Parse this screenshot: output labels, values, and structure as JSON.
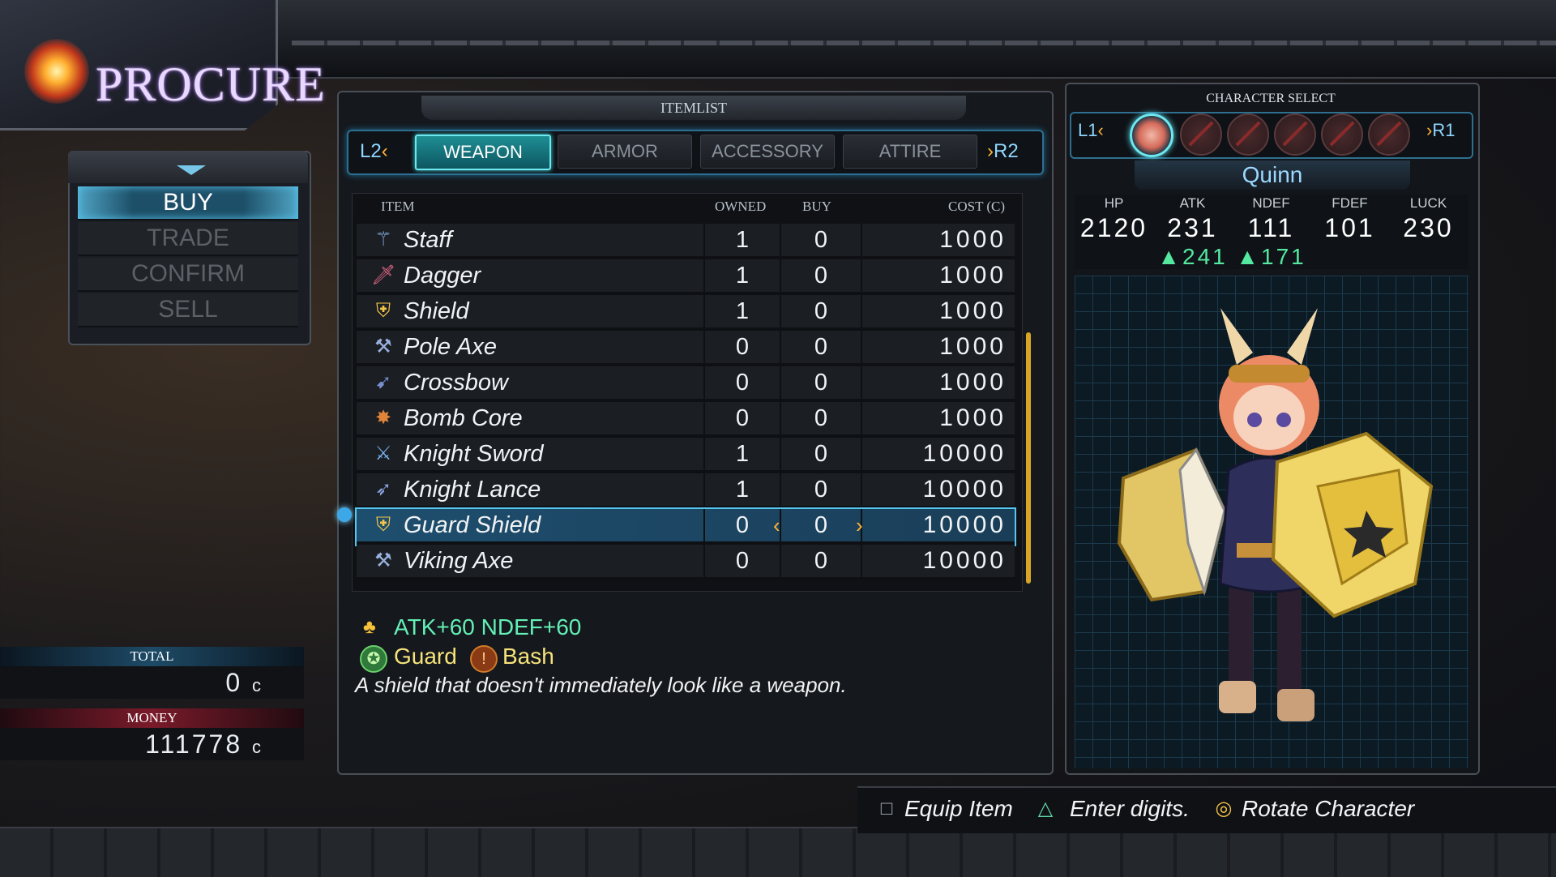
{
  "screen": {
    "title": "PROCURE"
  },
  "menu": {
    "items": [
      "BUY",
      "TRADE",
      "CONFIRM",
      "SELL"
    ],
    "active": "BUY"
  },
  "totals": {
    "total_label": "TOTAL",
    "total_value": "0",
    "money_label": "MONEY",
    "money_value": "111778",
    "currency": "c"
  },
  "itemlist": {
    "header": "ITEMLIST",
    "tab_left": "L2",
    "tab_right": "R2",
    "tabs": [
      "WEAPON",
      "ARMOR",
      "ACCESSORY",
      "ATTIRE"
    ],
    "active_tab": "WEAPON",
    "columns": {
      "item": "ITEM",
      "owned": "OWNED",
      "buy": "BUY",
      "cost": "COST (C)"
    },
    "rows": [
      {
        "name": "Staff",
        "owned": "1",
        "buy": "0",
        "cost": "1000",
        "icon": "staff-icon"
      },
      {
        "name": "Dagger",
        "owned": "1",
        "buy": "0",
        "cost": "1000",
        "icon": "dagger-icon"
      },
      {
        "name": "Shield",
        "owned": "1",
        "buy": "0",
        "cost": "1000",
        "icon": "shield-icon"
      },
      {
        "name": "Pole Axe",
        "owned": "0",
        "buy": "0",
        "cost": "1000",
        "icon": "axe-icon"
      },
      {
        "name": "Crossbow",
        "owned": "0",
        "buy": "0",
        "cost": "1000",
        "icon": "crossbow-icon"
      },
      {
        "name": "Bomb Core",
        "owned": "0",
        "buy": "0",
        "cost": "1000",
        "icon": "bomb-icon"
      },
      {
        "name": "Knight Sword",
        "owned": "1",
        "buy": "0",
        "cost": "10000",
        "icon": "sword-icon"
      },
      {
        "name": "Knight Lance",
        "owned": "1",
        "buy": "0",
        "cost": "10000",
        "icon": "lance-icon"
      },
      {
        "name": "Guard Shield",
        "owned": "0",
        "buy": "0",
        "cost": "10000",
        "icon": "shield-icon",
        "selected": true
      },
      {
        "name": "Viking Axe",
        "owned": "0",
        "buy": "0",
        "cost": "10000",
        "icon": "axe-icon"
      }
    ]
  },
  "description": {
    "stats": "ATK+60 NDEF+60",
    "skill1": "Guard",
    "skill2": "Bash",
    "text": "A shield that doesn't immediately look like a weapon."
  },
  "character": {
    "select_label": "CHARACTER SELECT",
    "left": "L1",
    "right": "R1",
    "name": "Quinn",
    "stats": [
      {
        "label": "HP",
        "value": "2120",
        "up": ""
      },
      {
        "label": "ATK",
        "value": "231",
        "up": "▲241"
      },
      {
        "label": "NDEF",
        "value": "111",
        "up": "▲171"
      },
      {
        "label": "FDEF",
        "value": "101",
        "up": ""
      },
      {
        "label": "LUCK",
        "value": "230",
        "up": ""
      }
    ]
  },
  "hints": {
    "equip": "Equip Item",
    "digits": "Enter digits.",
    "rotate": "Rotate Character"
  },
  "colors": {
    "accent": "#58c5ee",
    "highlight": "#63f0b6",
    "skill": "#f6e37a"
  }
}
